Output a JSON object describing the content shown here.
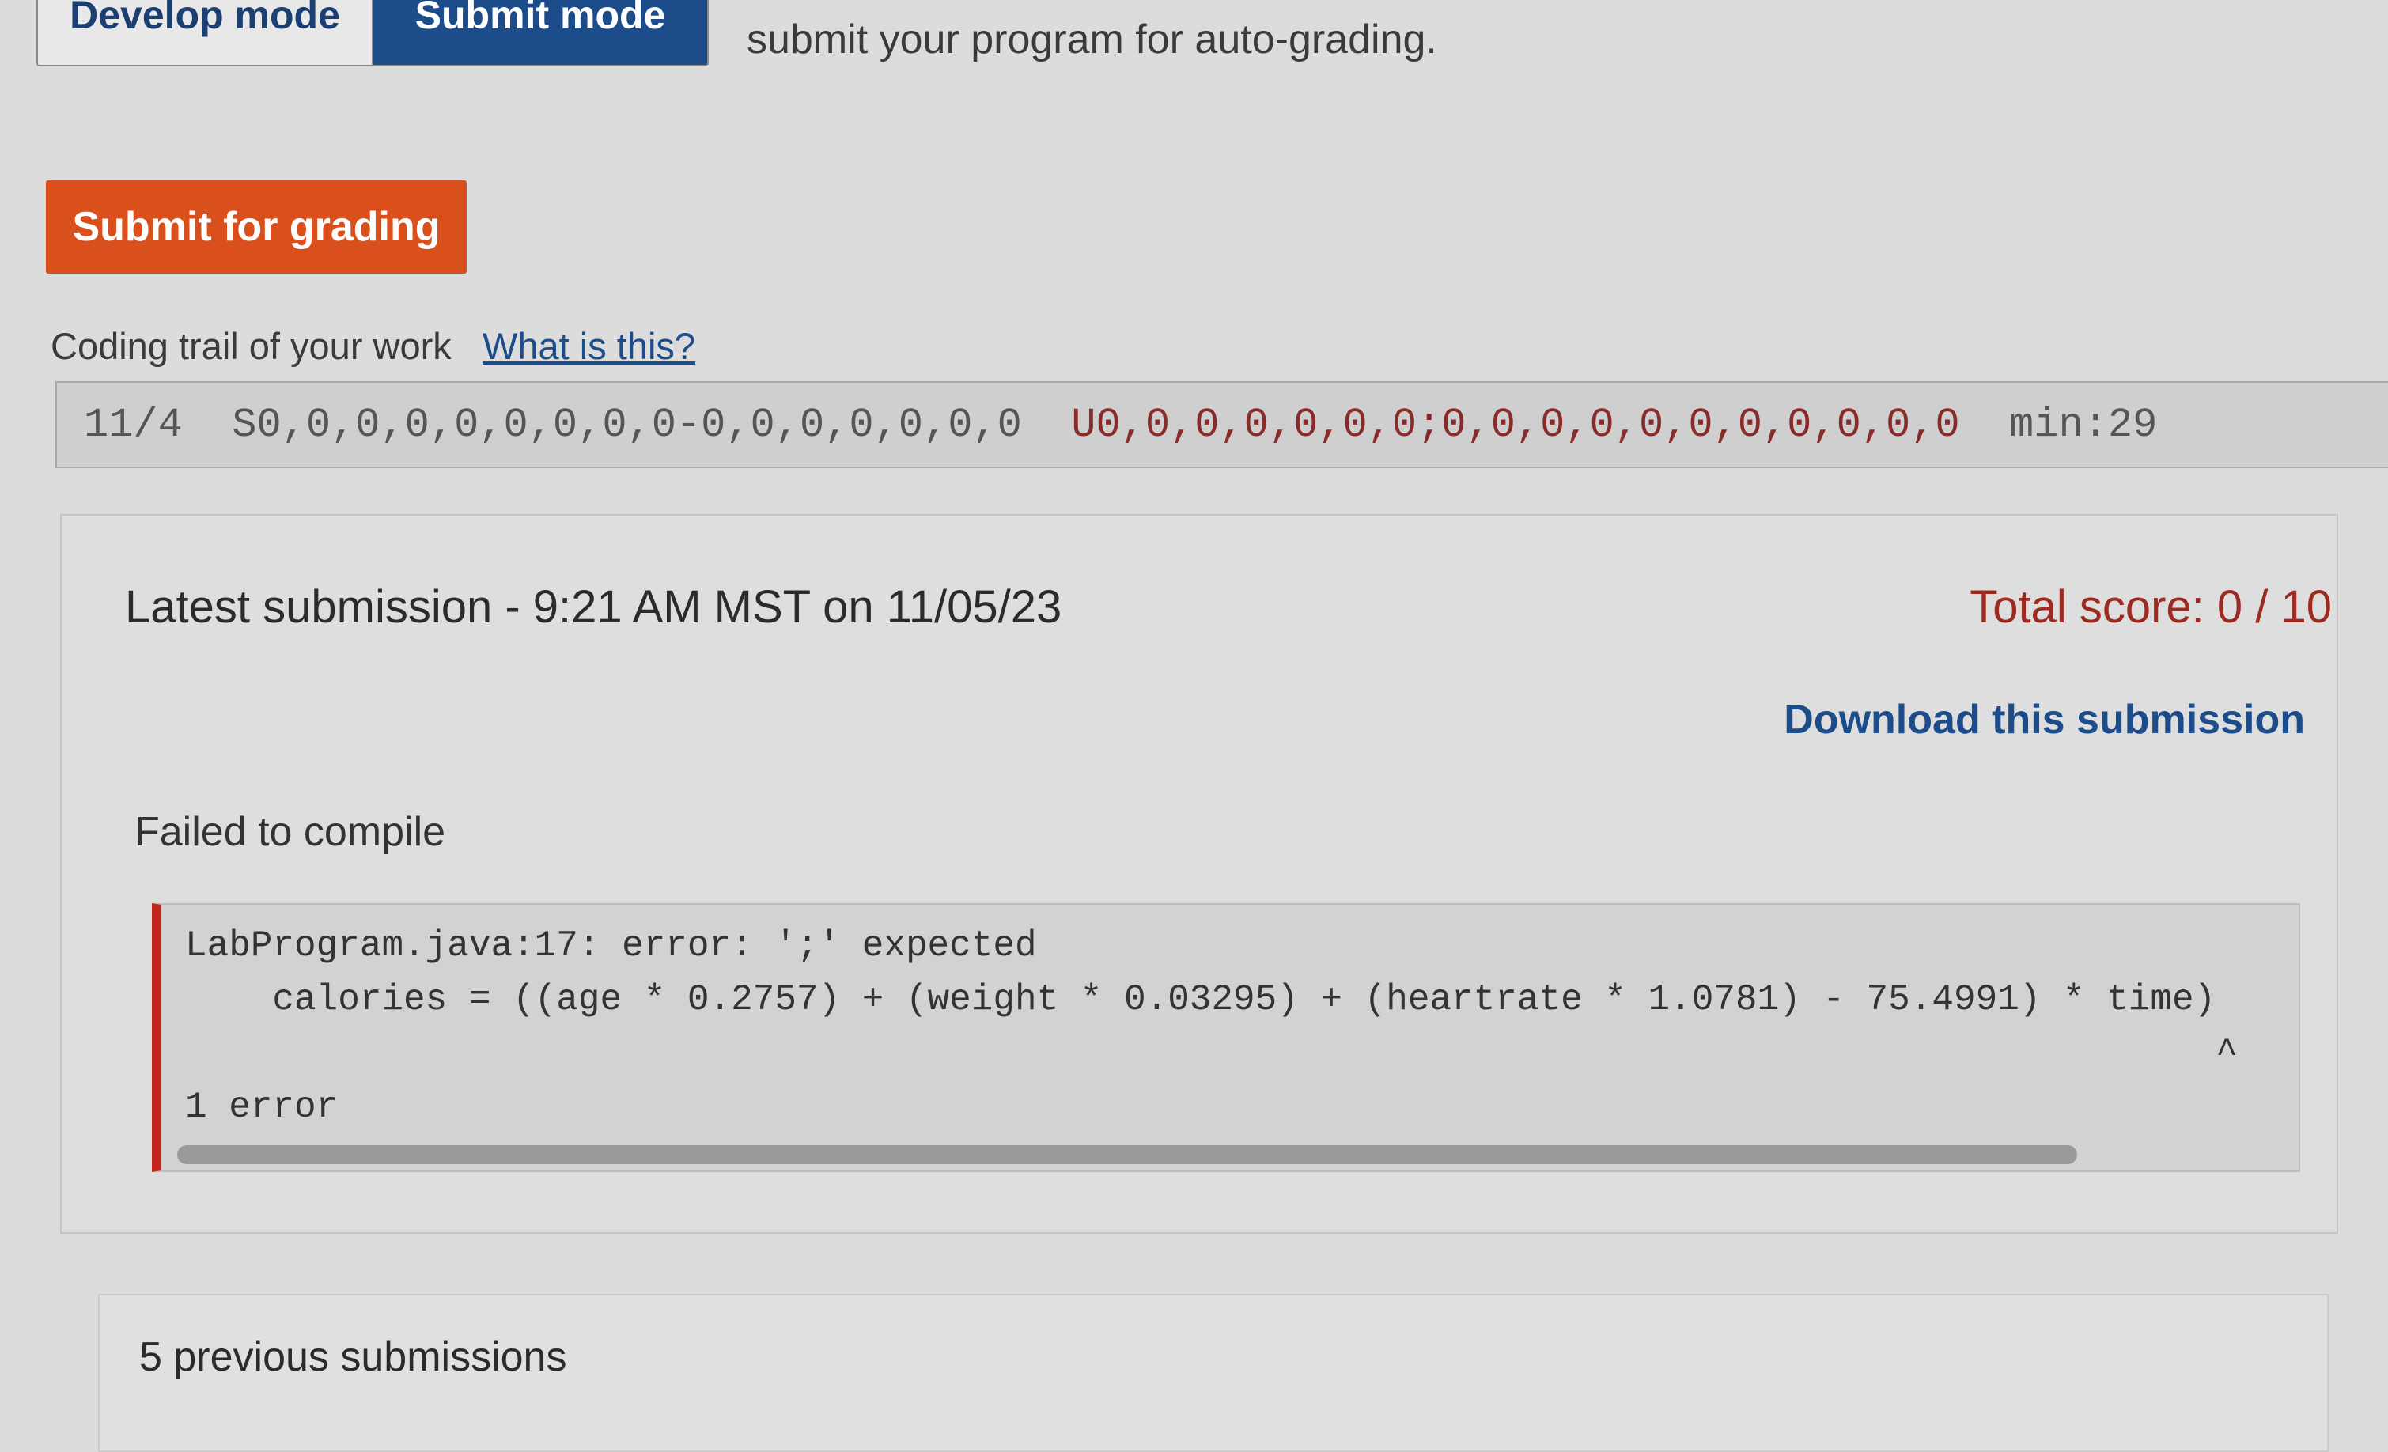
{
  "mode_tabs": {
    "develop": "Develop mode",
    "submit": "Submit mode"
  },
  "intro_text": "submit your program for auto-grading.",
  "submit_button": "Submit for grading",
  "coding_trail": {
    "label": "Coding trail of your work",
    "help_link": "What is this?",
    "date": "11/4",
    "s_part": "S0,0,0,0,0,0,0,0,0-0,0,0,0,0,0,0",
    "u_part": "U0,0,0,0,0,0,0;0,0,0,0,0,0,0,0,0,0,0",
    "min_label": "min:29"
  },
  "latest_submission": {
    "title": "Latest submission - 9:21 AM MST on 11/05/23",
    "total_score": "Total score: 0 / 10",
    "download_link": "Download this submission",
    "status": "Failed to compile",
    "error_output": "LabProgram.java:17: error: ';' expected\n    calories = ((age * 0.2757) + (weight * 0.03295) + (heartrate * 1.0781) - 75.4991) * time)\n                                                                                             ^\n1 error"
  },
  "previous_submissions": "5 previous submissions",
  "colors": {
    "submit_button": "#d9501d",
    "score": "#9c2a21",
    "link": "#1c4d8a",
    "error_border": "#c2261c"
  }
}
